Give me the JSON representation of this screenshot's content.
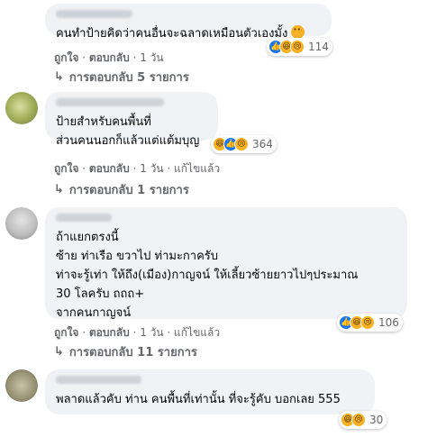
{
  "comments": [
    {
      "text": "คนทำป้ายคิดว่าคนอื่นจะฉลาดเหมือนตัวเองมั้ง",
      "reaction_count": "114",
      "like_label": "ถูกใจ",
      "reply_label": "ตอบกลับ",
      "time": "1 วัน",
      "edited": "",
      "replies_label": "การตอบกลับ 5 รายการ"
    },
    {
      "text": "ป้ายสำหรับคนพื้นที่\nส่วนคนนอกก็แล้วแต่แต้มบุญ",
      "reaction_count": "364",
      "like_label": "ถูกใจ",
      "reply_label": "ตอบกลับ",
      "time": "1 วัน",
      "edited": "แก้ไขแล้ว",
      "replies_label": "การตอบกลับ 1 รายการ"
    },
    {
      "text": "ถ้าแยกตรงนี้\nซ้าย ท่าเรือ ขวาไป ท่ามะกาครับ\nท่าจะรู้เท่า ให้ถึง(เมือง)กาญจน์ ให้เลี้ยวซ้ายยาวไปๆประมาณ\n30 โลครับ ถถถ+\nจากคนกาญจน์",
      "reaction_count": "106",
      "like_label": "ถูกใจ",
      "reply_label": "ตอบกลับ",
      "time": "1 วัน",
      "edited": "แก้ไขแล้ว",
      "replies_label": "การตอบกลับ 11 รายการ"
    },
    {
      "text": "พลาดแล้วคับ ท่าน คนพื้นที่เท่านั้น ที่จะรู้คับ บอกเลย 555",
      "reaction_count": "30"
    }
  ],
  "icons": {
    "like": "like-reaction-icon",
    "haha": "haha-reaction-icon",
    "sad": "sad-reaction-icon",
    "reply_arrow": "reply-arrow-icon"
  },
  "colors": {
    "like": "#1877f2",
    "haha": "#f7b125",
    "bubble": "#f0f2f5",
    "meta": "#65676b"
  }
}
